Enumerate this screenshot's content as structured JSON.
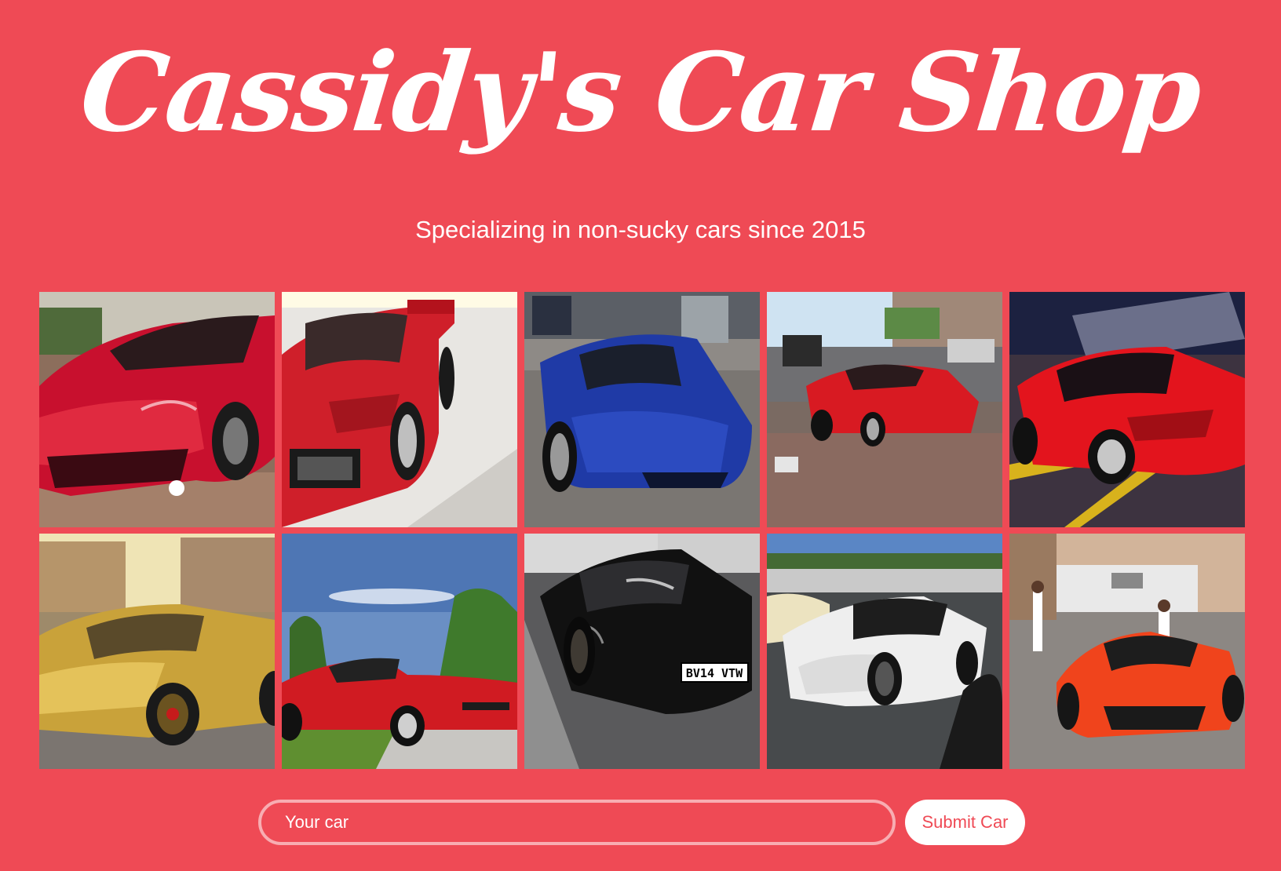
{
  "header": {
    "title": "Cassidy's Car Shop",
    "subtitle": "Specializing in non-sucky cars since 2015"
  },
  "gallery": {
    "items": [
      {
        "name": "car-photo-red-ferrari-f12",
        "color": "#c8102e"
      },
      {
        "name": "car-photo-red-ferrari-f40",
        "color": "#cf1f2a"
      },
      {
        "name": "car-photo-blue-ferrari-458",
        "color": "#1f3aa6"
      },
      {
        "name": "car-photo-red-ferrari-458-street",
        "color": "#d81a22"
      },
      {
        "name": "car-photo-red-ferrari-458-parking",
        "color": "#e3141d"
      },
      {
        "name": "car-photo-gold-ferrari",
        "color": "#c9a23a"
      },
      {
        "name": "car-photo-red-ferrari-gto",
        "color": "#d01b22"
      },
      {
        "name": "car-photo-black-ferrari-f12",
        "color": "#111111"
      },
      {
        "name": "car-photo-white-ferrari-599",
        "color": "#eeeeee"
      },
      {
        "name": "car-photo-orange-laferrari",
        "color": "#f0441c"
      }
    ],
    "plate_text": "BV14 VTW"
  },
  "form": {
    "input_placeholder": "Your car",
    "submit_label": "Submit Car"
  },
  "colors": {
    "background": "#ef4a55",
    "text": "#ffffff"
  }
}
